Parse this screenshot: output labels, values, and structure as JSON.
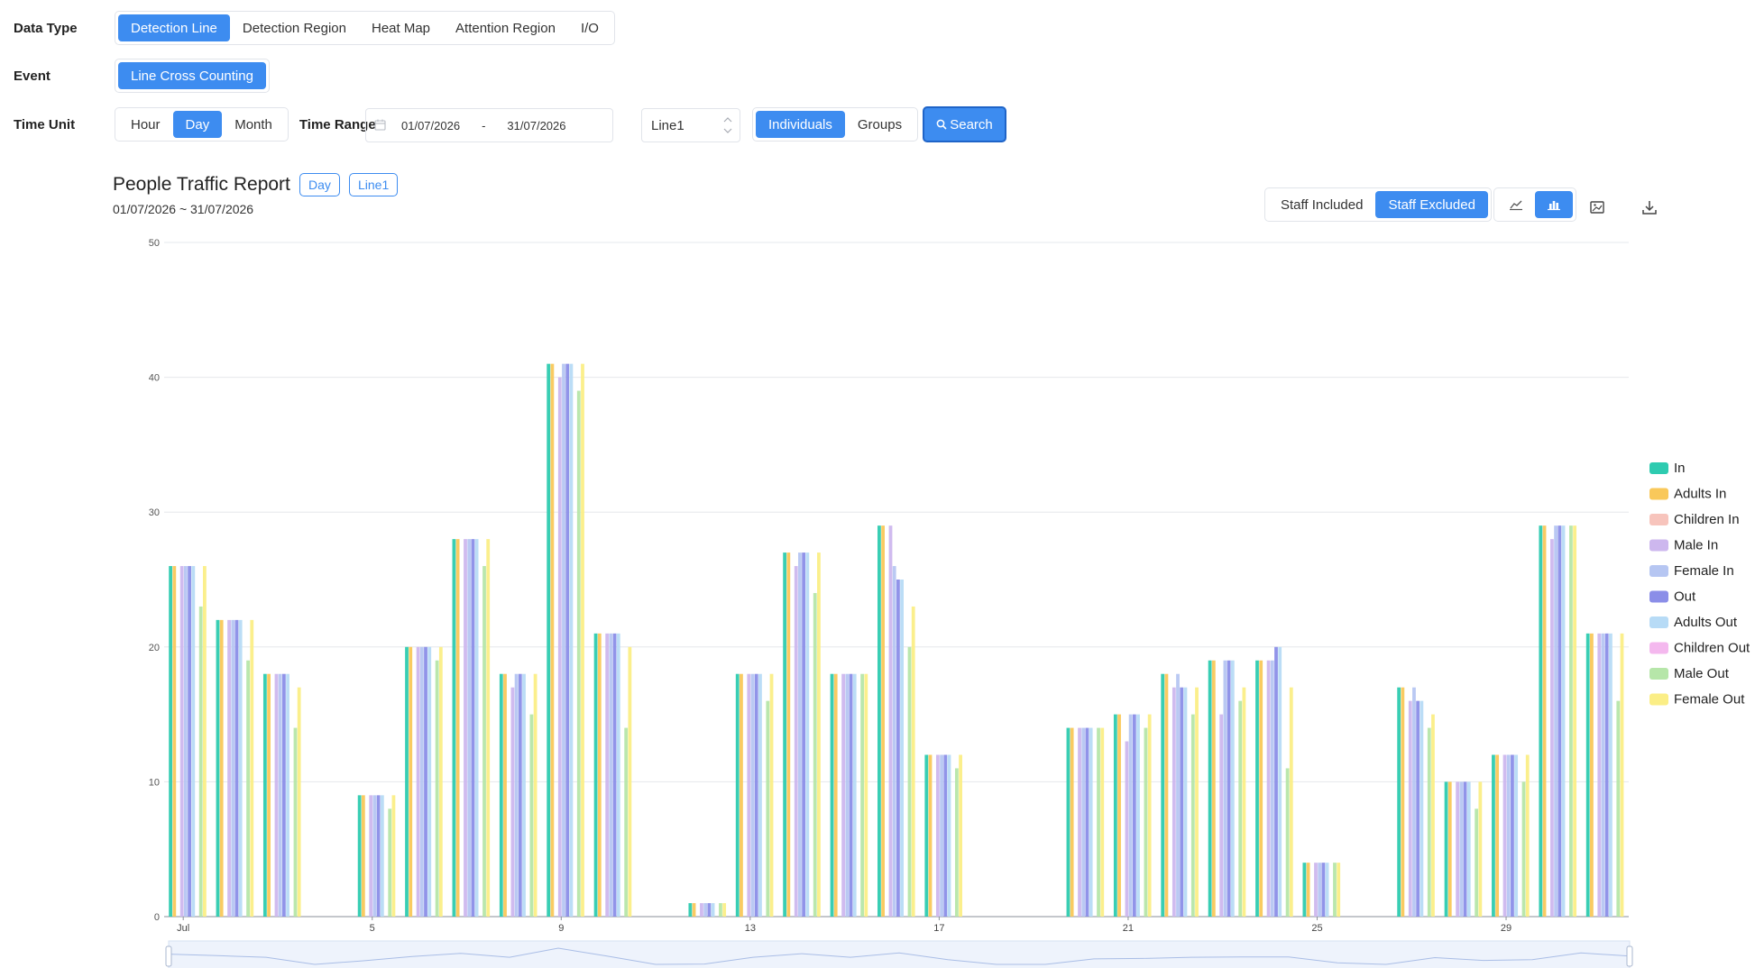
{
  "filters": {
    "data_type": {
      "label": "Data Type",
      "options": [
        "Detection Line",
        "Detection Region",
        "Heat Map",
        "Attention Region",
        "I/O"
      ],
      "selected": "Detection Line"
    },
    "event": {
      "label": "Event",
      "options": [
        "Line Cross Counting"
      ],
      "selected": "Line Cross Counting"
    },
    "time_unit": {
      "label": "Time Unit",
      "options": [
        "Hour",
        "Day",
        "Month"
      ],
      "selected": "Day"
    },
    "time_range": {
      "label": "Time Range",
      "start": "01/07/2026",
      "separator": "-",
      "end": "31/07/2026"
    },
    "line_select": {
      "value": "Line1"
    },
    "grouping": {
      "options": [
        "Individuals",
        "Groups"
      ],
      "selected": "Individuals"
    },
    "search_label": "Search"
  },
  "report": {
    "title": "People Traffic Report",
    "tag_unit": "Day",
    "tag_line": "Line1",
    "date_range": "01/07/2026 ~ 31/07/2026",
    "staff_toggle": {
      "options": [
        "Staff Included",
        "Staff Excluded"
      ],
      "selected": "Staff Excluded"
    },
    "chart_modes": [
      "line-chart-icon",
      "bar-chart-icon"
    ],
    "selected_mode": "bar-chart-icon",
    "extra_actions": [
      "save-image-icon",
      "download-icon"
    ]
  },
  "colors": {
    "accent": "#3d8cf0",
    "series": [
      "#2ecbb0",
      "#f9c85a",
      "#f7c4bc",
      "#cdb7ee",
      "#b6c6f2",
      "#8b8ee8",
      "#b7dbf6",
      "#f4b8ee",
      "#b6e6a9",
      "#fbee86"
    ]
  },
  "chart_data": {
    "type": "bar",
    "title": "",
    "xlabel": "",
    "ylabel": "",
    "ylim": [
      0,
      50
    ],
    "yticks": [
      0,
      10,
      20,
      30,
      40,
      50
    ],
    "grid": true,
    "legend_position": "right",
    "categories": [
      "Jul",
      "2",
      "3",
      "4",
      "5",
      "6",
      "7",
      "8",
      "9",
      "10",
      "11",
      "12",
      "13",
      "14",
      "15",
      "16",
      "17",
      "18",
      "19",
      "20",
      "21",
      "22",
      "23",
      "24",
      "25",
      "26",
      "27",
      "28",
      "29",
      "30",
      "31"
    ],
    "xtick_labels": {
      "0": "Jul",
      "4": "5",
      "8": "9",
      "12": "13",
      "16": "17",
      "20": "21",
      "24": "25",
      "28": "29"
    },
    "series": [
      {
        "name": "In",
        "values": [
          26,
          22,
          18,
          0,
          9,
          20,
          28,
          18,
          41,
          21,
          0,
          1,
          18,
          27,
          18,
          29,
          12,
          0,
          0,
          14,
          15,
          18,
          19,
          19,
          4,
          0,
          17,
          10,
          12,
          29,
          21
        ]
      },
      {
        "name": "Adults In",
        "values": [
          26,
          22,
          18,
          0,
          9,
          20,
          28,
          18,
          41,
          21,
          0,
          1,
          18,
          27,
          18,
          29,
          12,
          0,
          0,
          14,
          15,
          18,
          19,
          19,
          4,
          0,
          17,
          10,
          12,
          29,
          21
        ]
      },
      {
        "name": "Children In",
        "values": [
          0,
          0,
          0,
          0,
          0,
          0,
          0,
          0,
          0,
          0,
          0,
          0,
          0,
          0,
          0,
          0,
          0,
          0,
          0,
          0,
          0,
          0,
          0,
          0,
          0,
          0,
          0,
          0,
          0,
          0,
          0
        ]
      },
      {
        "name": "Male In",
        "values": [
          26,
          22,
          18,
          0,
          9,
          20,
          28,
          17,
          40,
          21,
          0,
          1,
          18,
          26,
          18,
          29,
          12,
          0,
          0,
          14,
          13,
          17,
          15,
          19,
          4,
          0,
          16,
          10,
          12,
          28,
          21
        ]
      },
      {
        "name": "Female In",
        "values": [
          26,
          22,
          18,
          0,
          9,
          20,
          28,
          18,
          41,
          21,
          0,
          1,
          18,
          27,
          18,
          26,
          12,
          0,
          0,
          14,
          15,
          18,
          19,
          19,
          4,
          0,
          17,
          10,
          12,
          29,
          21
        ]
      },
      {
        "name": "Out",
        "values": [
          26,
          22,
          18,
          0,
          9,
          20,
          28,
          18,
          41,
          21,
          0,
          1,
          18,
          27,
          18,
          25,
          12,
          0,
          0,
          14,
          15,
          17,
          19,
          20,
          4,
          0,
          16,
          10,
          12,
          29,
          21
        ]
      },
      {
        "name": "Adults Out",
        "values": [
          26,
          22,
          18,
          0,
          9,
          20,
          28,
          18,
          41,
          21,
          0,
          1,
          18,
          27,
          18,
          25,
          12,
          0,
          0,
          14,
          15,
          17,
          19,
          20,
          4,
          0,
          16,
          10,
          12,
          29,
          21
        ]
      },
      {
        "name": "Children Out",
        "values": [
          0,
          0,
          0,
          0,
          0,
          0,
          0,
          0,
          0,
          0,
          0,
          0,
          0,
          0,
          0,
          0,
          0,
          0,
          0,
          0,
          0,
          0,
          0,
          0,
          0,
          0,
          0,
          0,
          0,
          0,
          0
        ]
      },
      {
        "name": "Male Out",
        "values": [
          23,
          19,
          14,
          0,
          8,
          19,
          26,
          15,
          39,
          14,
          0,
          1,
          16,
          24,
          18,
          20,
          11,
          0,
          0,
          14,
          14,
          15,
          16,
          11,
          4,
          0,
          14,
          8,
          10,
          29,
          16
        ]
      },
      {
        "name": "Female Out",
        "values": [
          26,
          22,
          17,
          0,
          9,
          20,
          28,
          18,
          41,
          20,
          0,
          1,
          18,
          27,
          18,
          23,
          12,
          0,
          0,
          14,
          15,
          17,
          17,
          17,
          4,
          0,
          15,
          10,
          12,
          29,
          21
        ]
      }
    ]
  }
}
